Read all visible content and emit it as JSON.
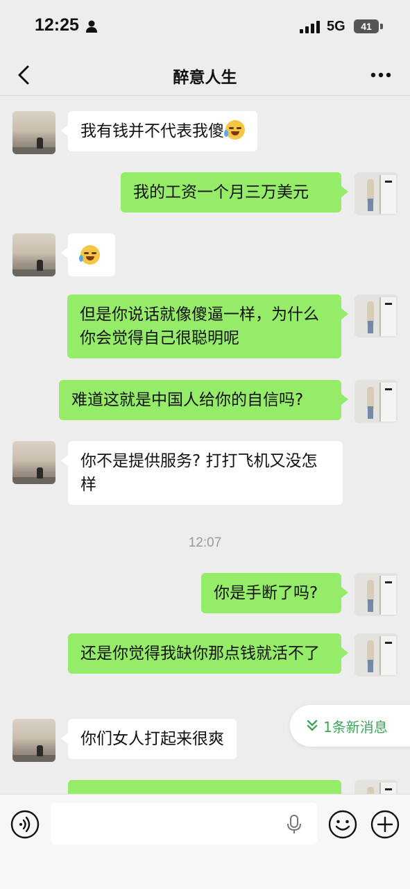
{
  "status_bar": {
    "time": "12:25",
    "network": "5G",
    "battery": "41"
  },
  "nav": {
    "title": "醉意人生"
  },
  "messages": [
    {
      "side": "recv",
      "text": "我有钱并不代表我傻",
      "emoji": "laugh-cry"
    },
    {
      "side": "sent",
      "text": "我的工资一个月三万美元"
    },
    {
      "side": "recv",
      "text": "",
      "emoji": "laugh-cry"
    },
    {
      "side": "sent",
      "text": "但是你说话就像傻逼一样，为什么你会觉得自己很聪明呢"
    },
    {
      "side": "sent",
      "text": "难道这就是中国人给你的自信吗?"
    },
    {
      "side": "recv",
      "text": "你不是提供服务? 打打飞机又没怎样"
    },
    {
      "side": "sent",
      "text": "你是手断了吗?"
    },
    {
      "side": "sent",
      "text": "还是你觉得我缺你那点钱就活不了"
    },
    {
      "side": "recv",
      "text": "你们女人打起来很爽"
    }
  ],
  "timestamp": "12:07",
  "new_messages": {
    "label": "1条新消息"
  },
  "input": {
    "value": "",
    "placeholder": ""
  },
  "colors": {
    "background": "#ededed",
    "sent_bubble": "#95ec69",
    "recv_bubble": "#ffffff",
    "accent": "#3fa35a"
  }
}
